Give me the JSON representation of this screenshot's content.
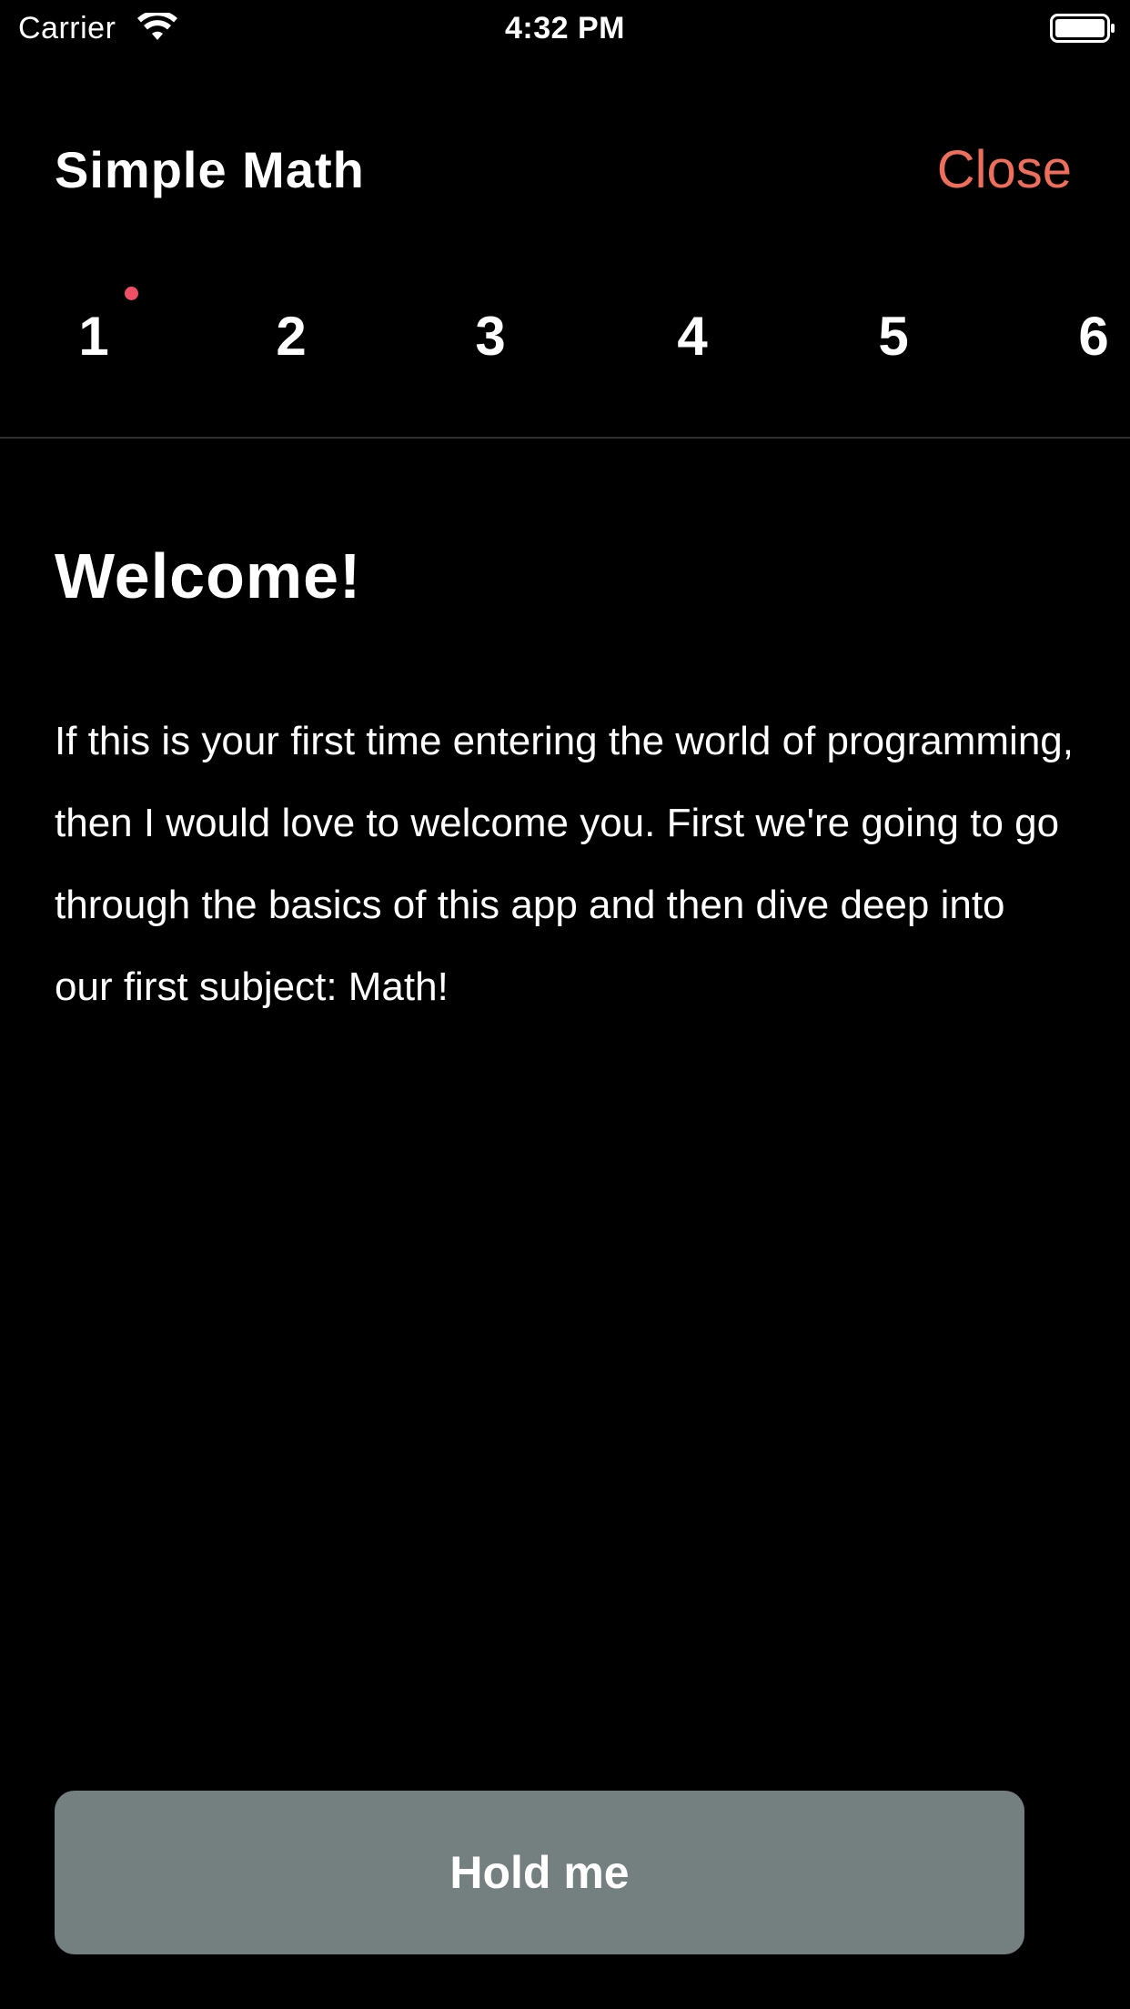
{
  "status_bar": {
    "carrier": "Carrier",
    "time": "4:32 PM",
    "icons": [
      "wifi-icon",
      "battery-icon"
    ]
  },
  "header": {
    "title": "Simple Math",
    "close_label": "Close"
  },
  "steps": {
    "items": [
      "1",
      "2",
      "3",
      "4",
      "5",
      "6"
    ],
    "active_index": 0,
    "indicator_color": "#ee4f64"
  },
  "content": {
    "heading": "Welcome!",
    "body": "If this is your first time entering the world of programming, then I would love to welcome you. First we're going to go through the basics of this app and then dive deep into our first subject: Math!"
  },
  "action": {
    "hold_label": "Hold me"
  },
  "colors": {
    "background": "#000000",
    "accent": "#ef6d5b",
    "button": "#747f80",
    "text": "#ffffff"
  }
}
